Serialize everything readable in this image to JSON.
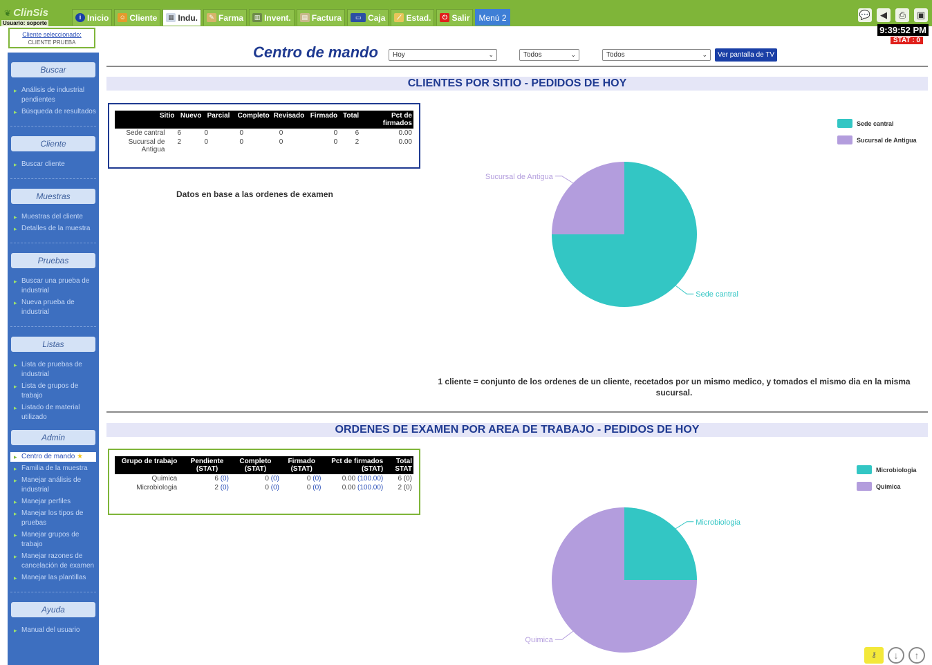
{
  "topbar": {
    "brand": "ClinSis",
    "user_label": "Usuario: soporte",
    "tabs": [
      {
        "label": "Inicio",
        "icon": "info-icon"
      },
      {
        "label": "Cliente",
        "icon": "people-icon"
      },
      {
        "label": "Indu.",
        "icon": "grid-icon",
        "active": true
      },
      {
        "label": "Farma",
        "icon": "pill-icon"
      },
      {
        "label": "Invent.",
        "icon": "barcode-icon"
      },
      {
        "label": "Factura",
        "icon": "invoice-icon"
      },
      {
        "label": "Caja",
        "icon": "card-icon"
      },
      {
        "label": "Estad.",
        "icon": "chart-icon"
      },
      {
        "label": "Salir",
        "icon": "exit-icon"
      },
      {
        "label": "Menú 2",
        "icon": ""
      }
    ],
    "right_icons": [
      "chat-icon",
      "back-icon",
      "print-icon",
      "window-icon"
    ],
    "clock": "9:39:52 PM",
    "stat": "STAT : 0",
    "colors": {
      "bar": "#7fb539",
      "stat": "#e0201b"
    }
  },
  "client_box": {
    "link": "Cliente seleccionado:",
    "name": "CLIENTE PRUEBA"
  },
  "sidebar": {
    "sections": [
      {
        "title": "Buscar",
        "items": [
          "Análisis de industrial pendientes",
          "Búsqueda de resultados"
        ]
      },
      {
        "title": "Cliente",
        "items": [
          "Buscar cliente"
        ]
      },
      {
        "title": "Muestras",
        "items": [
          "Muestras del cliente",
          "Detalles de la muestra"
        ]
      },
      {
        "title": "Pruebas",
        "items": [
          "Buscar una prueba de industrial",
          "Nueva prueba de industrial"
        ]
      },
      {
        "title": "Listas",
        "items": [
          "Lista de pruebas de industrial",
          "Lista de grupos de trabajo",
          "Listado de material utilizado"
        ]
      },
      {
        "title": "Admin",
        "items": [
          "Centro de mando",
          "Familia de la muestra",
          "Manejar análisis de industrial",
          "Manejar perfiles",
          "Manejar los tipos de pruebas",
          "Manejar grupos de trabajo",
          "Manejar razones de cancelación de examen",
          "Manejar las plantillas"
        ]
      },
      {
        "title": "Ayuda",
        "items": [
          "Manual del usuario"
        ]
      }
    ]
  },
  "header": {
    "title": "Centro de mando",
    "period_select": "Hoy",
    "filter1_select": "Todos",
    "filter2_select": "Todos",
    "tv_button": "Ver pantalla de TV"
  },
  "section1": {
    "title": "CLIENTES POR SITIO - PEDIDOS DE HOY",
    "table": {
      "headers": [
        "Sitio",
        "Nuevo",
        "Parcial",
        "Completo",
        "Revisado",
        "Firmado",
        "Total",
        "Pct de firmados"
      ],
      "rows": [
        [
          "Sede cantral",
          "6",
          "0",
          "0",
          "0",
          "0",
          "6",
          "0.00"
        ],
        [
          "Sucursal de Antigua",
          "2",
          "0",
          "0",
          "0",
          "0",
          "2",
          "0.00"
        ]
      ]
    },
    "note": "Datos en base a las ordenes de examen",
    "footnote": "1 cliente = conjunto de los ordenes de un cliente, recetados por un mismo medico, y tomados el mismo dia en la misma sucursal."
  },
  "section2": {
    "title": "ORDENES DE EXAMEN POR AREA DE TRABAJO - PEDIDOS DE HOY",
    "table": {
      "headers": [
        "Grupo de trabajo",
        "Pendiente (STAT)",
        "Completo (STAT)",
        "Firmado (STAT)",
        "Pct de firmados (STAT)",
        "Total STAT"
      ],
      "rows": [
        {
          "grupo": "Quimica",
          "pend": "6",
          "pend_stat": "(0)",
          "comp": "0",
          "comp_stat": "(0)",
          "firm": "0",
          "firm_stat": "(0)",
          "pct": "0.00",
          "pct_stat": "(100.00)",
          "total": "6 (0)"
        },
        {
          "grupo": "Microbiologia",
          "pend": "2",
          "pend_stat": "(0)",
          "comp": "0",
          "comp_stat": "(0)",
          "firm": "0",
          "firm_stat": "(0)",
          "pct": "0.00",
          "pct_stat": "(100.00)",
          "total": "2 (0)"
        }
      ]
    }
  },
  "chart_data": [
    {
      "type": "pie",
      "categories": [
        "Sede cantral",
        "Sucursal de Antigua"
      ],
      "values": [
        6,
        2
      ],
      "colors": [
        "#33c6c4",
        "#b39ddd"
      ],
      "legend": "top-right",
      "title": ""
    },
    {
      "type": "pie",
      "categories": [
        "Microbiologia",
        "Quimica"
      ],
      "values": [
        2,
        6
      ],
      "colors": [
        "#33c6c4",
        "#b39ddd"
      ],
      "legend": "top-right",
      "title": ""
    }
  ],
  "footer_icons": [
    "key-icon",
    "scroll-down-icon",
    "scroll-up-icon"
  ]
}
